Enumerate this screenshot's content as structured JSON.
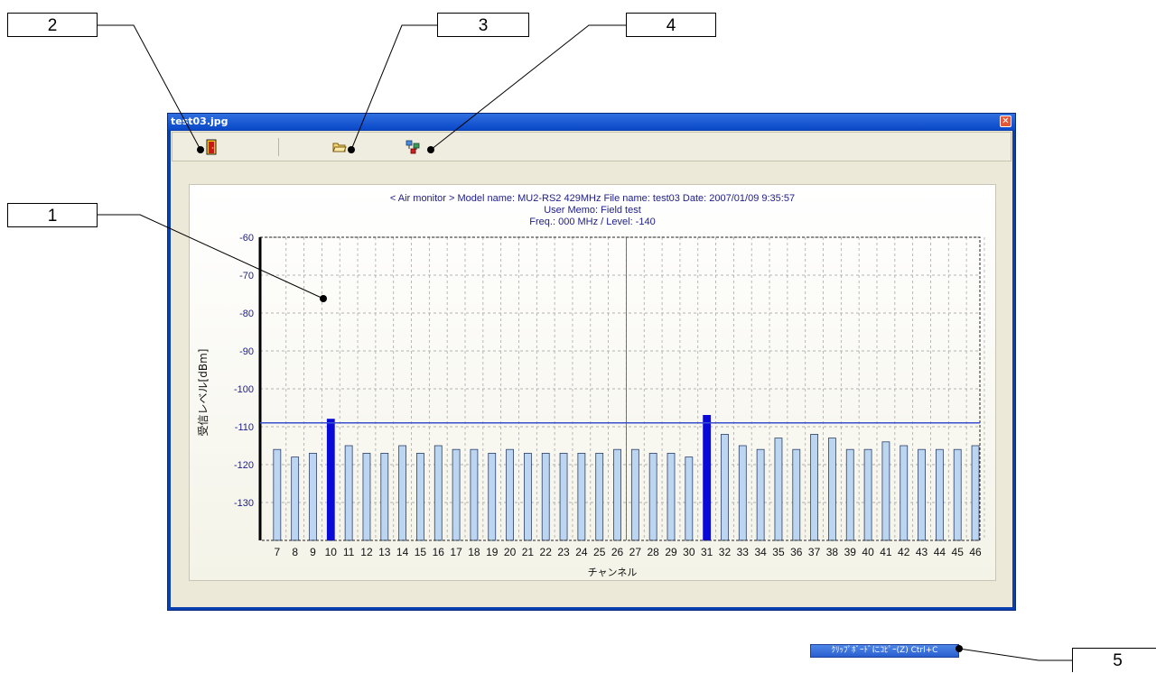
{
  "callouts": [
    "1",
    "2",
    "3",
    "4",
    "5"
  ],
  "window": {
    "title": "test03.jpg",
    "close_glyph": "✕"
  },
  "toolbar": {
    "icons": [
      "exit-door-icon",
      "open-folder-icon",
      "network-icon"
    ]
  },
  "clipboard_button": {
    "label": "ｸﾘｯﾌﾟﾎﾞｰﾄﾞにｺﾋﾟｰ(Z)  Ctrl+C"
  },
  "chart_data": {
    "type": "bar",
    "title": "< Air monitor >   Model name: MU2-RS2    429MHz    File name: test03    Date: 2007/01/09 9:35:57",
    "subtitle": "User Memo: Field test",
    "freq_level": "Freq.: 000 MHz   /   Level: -140",
    "xlabel": "チャンネル",
    "ylabel": "受信レベル[dBm]",
    "ylim": [
      -140,
      -60
    ],
    "yticks": [
      -60,
      -70,
      -80,
      -90,
      -100,
      -110,
      -120,
      -130
    ],
    "grid": true,
    "threshold": -109,
    "marker_channel": "27",
    "categories": [
      "7",
      "8",
      "9",
      "10",
      "11",
      "12",
      "13",
      "14",
      "15",
      "16",
      "17",
      "18",
      "19",
      "20",
      "21",
      "22",
      "23",
      "24",
      "25",
      "26",
      "27",
      "28",
      "29",
      "30",
      "31",
      "32",
      "33",
      "34",
      "35",
      "36",
      "37",
      "38",
      "39",
      "40",
      "41",
      "42",
      "43",
      "44",
      "45",
      "46"
    ],
    "values": [
      -116,
      -118,
      -117,
      -108,
      -115,
      -117,
      -117,
      -115,
      -117,
      -115,
      -116,
      -116,
      -117,
      -116,
      -117,
      -117,
      -117,
      -117,
      -117,
      -116,
      -116,
      -117,
      -117,
      -118,
      -107,
      -112,
      -115,
      -116,
      -113,
      -116,
      -112,
      -113,
      -116,
      -116,
      -114,
      -115,
      -116,
      -116,
      -116,
      -115
    ],
    "highlight_channels": [
      "10",
      "31"
    ],
    "colors": {
      "bar": "#bcd6f2",
      "bar_border": "#2c3f68",
      "highlight": "#0a0ad8",
      "threshold": "#3a4fd0",
      "text": "#20208c"
    }
  }
}
